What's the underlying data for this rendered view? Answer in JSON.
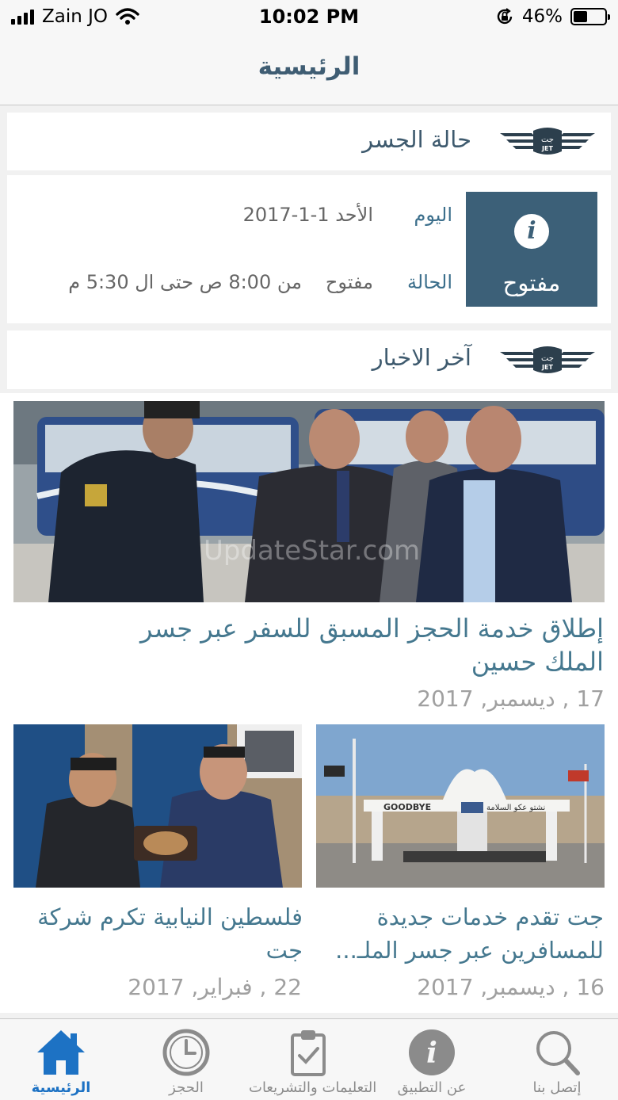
{
  "status_bar": {
    "carrier": "Zain JO",
    "time": "10:02 PM",
    "battery": "46%",
    "battery_level": 0.46
  },
  "nav": {
    "title": "الرئيسية"
  },
  "bridge": {
    "section_title": "حالة الجسر",
    "status_word": "مفتوح",
    "day_label": "اليوم",
    "day_value": "الأحد 1-1-2017",
    "state_label": "الحالة",
    "state_open": "مفتوح",
    "state_hours": "من 8:00 ص حتى ال 5:30 م"
  },
  "news": {
    "section_title": "آخر الاخبار",
    "featured": {
      "title": "إطلاق خدمة الحجز المسبق للسفر عبر جسر الملك حسين",
      "date": "17 , ديسمبر, 2017",
      "watermark": "UpdateStar.com"
    },
    "items": [
      {
        "title": "جت تقدم خدمات جديدة للمسافرين عبر جسر الملـ...",
        "date": "16 , ديسمبر, 2017",
        "sign_text": "GOODBYE",
        "sign_text_ar": "نشتو عكو السلامة"
      },
      {
        "title": "فلسطين النيابية تكرم شركة جت",
        "date": "22 , فبراير, 2017"
      }
    ]
  },
  "tabs": [
    {
      "label": "الرئيسية",
      "icon": "home-icon",
      "active": true
    },
    {
      "label": "الحجز",
      "icon": "clock-icon",
      "active": false
    },
    {
      "label": "التعليمات والتشريعات",
      "icon": "clipboard-check-icon",
      "active": false
    },
    {
      "label": "عن التطبيق",
      "icon": "info-icon",
      "active": false
    },
    {
      "label": "إتصل بنا",
      "icon": "search-icon",
      "active": false
    }
  ],
  "colors": {
    "accent": "#3c6078",
    "title_blue": "#45788f",
    "tab_active": "#1d72c4",
    "tab_inactive": "#8b8b8b"
  }
}
